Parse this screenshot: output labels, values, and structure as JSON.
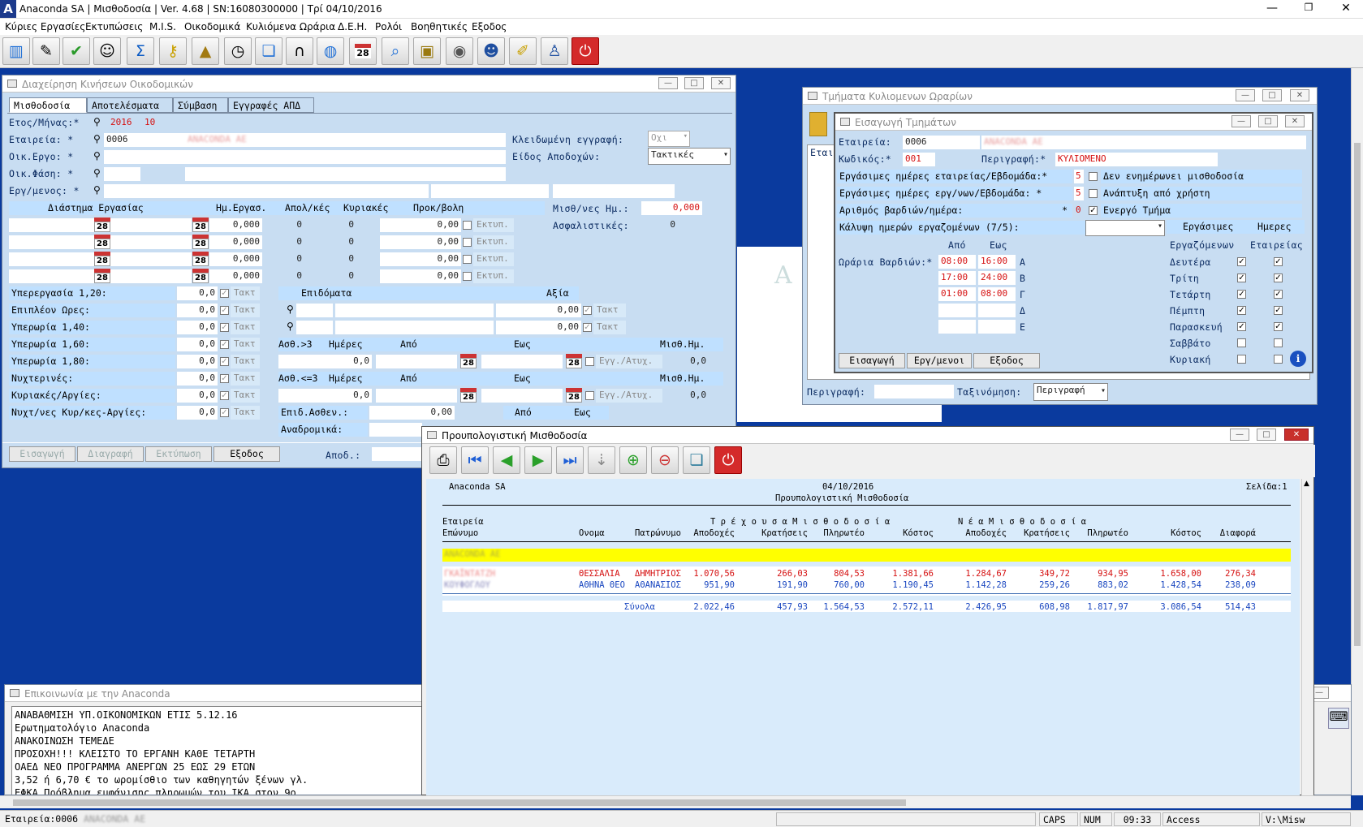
{
  "app": {
    "title": "Anaconda SA | Μισθοδοσία  | Ver. 4.68 | SN:16080300000 | Τρί 04/10/2016"
  },
  "menu": [
    "Κύριες Εργασίες",
    "Εκτυπώσεις",
    "M.I.S.",
    "Οικοδομικά",
    "Κυλιόμενα Ωράρια",
    "Δ.Ε.Η.",
    "Ρολόι",
    "Βοηθητικές",
    "Εξοδος"
  ],
  "toolbar": [
    "building-icon",
    "tools-icon",
    "checklist-icon",
    "users-icon",
    "sigma-icon",
    "key-icon",
    "pyramid-icon",
    "clock-icon",
    "book-icon",
    "headset-icon",
    "globe-icon",
    "calendar-icon",
    "search-screen-icon",
    "lock-icon",
    "database-icon",
    "user-icon",
    "notepad-icon",
    "user-stamp-icon",
    "power-icon"
  ],
  "calendar_day": "28",
  "w1": {
    "title": "Διαχείρηση Κινήσεων Οικοδομικών",
    "tabs": [
      "Μισθοδοσία",
      "Αποτελέσματα",
      "Σύμβαση",
      "Εγγραφές ΑΠΔ"
    ],
    "l_year": "Ετος/Μήνας:*",
    "year": "2016",
    "month": "10",
    "l_company": "Εταιρεία:  *",
    "company_code": "0006",
    "company_name": "ANACONDA AE",
    "l_locked": "Κλειδωμένη εγγραφή:",
    "locked": "Οχι",
    "l_project": "Οικ.Εργο:  *",
    "l_paytype": "Είδος Αποδοχών:",
    "paytype": "Τακτικές",
    "l_phase": "Οικ.Φάση:  *",
    "l_employee": "Εργ/μενος: *",
    "h_period": "Διάστημα Εργασίας",
    "h_days": "Ημ.Εργασ.",
    "h_abs": "Απολ/κές",
    "h_sun": "Κυριακές",
    "h_bonus": "Προκ/βολη",
    "l_wage": "Μισθ/νες Ημ.:",
    "wage": "0,000",
    "l_ins": "Ασφαλιστικές:",
    "ins": "0",
    "days": "0,000",
    "abs": "0",
    "sun": "0",
    "bonus": "0,00",
    "print": "Εκτυπ.",
    "ot_rows": [
      {
        "l": "Υπερεργασία 1,20:"
      },
      {
        "l": "Επιπλέον Ωρες:"
      },
      {
        "l": "Υπερωρία 1,40:"
      },
      {
        "l": "Υπερωρία 1,60:"
      },
      {
        "l": "Υπερωρία 1,80:"
      },
      {
        "l": "Νυχτερινές:"
      },
      {
        "l": "Κυριακές/Αργίες:"
      },
      {
        "l": "Νυχτ/νες Κυρ/κες-Αργίες:"
      }
    ],
    "ot_val": "0,0",
    "tact": "Τακτ",
    "h_benef": "Επιδόματα",
    "h_value": "Αξία",
    "benef_val": "0,00",
    "l_sick3": "Ασθ.>3",
    "l_sick3b": "Ασθ.<=3",
    "h_sdays": "Ημέρες",
    "h_from": "Από",
    "h_to": "Εως",
    "h_sw": "Μισθ.Ημ.",
    "sick_val": "0,0",
    "sick_chk": "Εγγ./Ατυχ.",
    "l_benef2": "Επιδ.Ασθεν.:",
    "benef2": "0,00",
    "l_retro": "Αναδρομικά:",
    "b_insert": "Εισαγωγή",
    "b_delete": "Διαγραφή",
    "b_print": "Εκτύπωση",
    "b_exit": "Εξοδος",
    "l_apod": "Αποδ.:"
  },
  "w2": {
    "title": "Τμήματα Κυλιομενων Ωραρίων",
    "l_company": "Εταιρ",
    "l_desc": "Περιγραφή:",
    "l_sort": "Ταξινόμηση:",
    "sort": "Περιγραφή"
  },
  "w3": {
    "title": "Εισαγωγή Τμημάτων",
    "l_company": "Εταιρεία:",
    "company_code": "0006",
    "company_name": "ANACONDA AE",
    "l_code": "Κωδικός:*",
    "code": "001",
    "l_desc": "Περιγραφή:*",
    "desc": "ΚΥΛΙΟΜΕΝΟ",
    "l_wd_c": "Εργάσιμες ημέρες εταιρείας/Εβδομάδα:*",
    "wd_c": "5",
    "chk1": "Δεν ενημέρωνει μισθοδοσία",
    "l_wd_e": "Εργάσιμες ημέρες εργ/νων/Εβδομάδα:  *",
    "wd_e": "5",
    "chk2": "Ανάπτυξη από χρήστη",
    "l_shifts": "Αριθμός βαρδιών/ημέρα:",
    "shifts": "0",
    "chk3": "Ενεργό Τμήμα",
    "l_cover": "Κάλυψη ημερών εργαζομένων (7/5):",
    "h_from": "Από",
    "h_to": "Εως",
    "l_sched": "Ωράρια Βαρδιών:*",
    "shifts_rows": [
      {
        "f": "08:00",
        "t": "16:00",
        "s": "Α"
      },
      {
        "f": "17:00",
        "t": "24:00",
        "s": "Β"
      },
      {
        "f": "01:00",
        "t": "08:00",
        "s": "Γ"
      },
      {
        "f": "",
        "t": "",
        "s": "Δ"
      },
      {
        "f": "",
        "t": "",
        "s": "Ε"
      }
    ],
    "h_wd": "Εργάσιμες",
    "h_days": "Ημερες",
    "h_emp": "Εργαζόμενων",
    "h_comp": "Εταιρείας",
    "days": [
      {
        "n": "Δευτέρα",
        "e": true,
        "c": true
      },
      {
        "n": "Τρίτη",
        "e": true,
        "c": true
      },
      {
        "n": "Τετάρτη",
        "e": true,
        "c": true
      },
      {
        "n": "Πέμπτη",
        "e": true,
        "c": true
      },
      {
        "n": "Παρασκευή",
        "e": true,
        "c": true
      },
      {
        "n": "Σαββάτο",
        "e": false,
        "c": false
      },
      {
        "n": "Κυριακή",
        "e": false,
        "c": false
      }
    ],
    "b_insert": "Εισαγωγή",
    "b_emp": "Εργ/μενοι",
    "b_exit": "Εξοδος"
  },
  "w4": {
    "title": "Προυπολογιστική Μισθοδοσία",
    "company": "Anaconda SA",
    "date": "04/10/2016",
    "page": "Σελίδα:1",
    "report": "Προυπολογιστική Μισθοδοσία",
    "g_cur": "Τ ρ έ χ ο υ σ α   Μ ι σ θ ο δ ο σ ί α",
    "g_new": "Ν έ α   Μ ι σ θ ο δ ο σ ί α",
    "h_company": "Εταιρεία",
    "h_surname": "Επώνυμο",
    "h_name": "Ονομα",
    "h_father": "Πατρώνυμο",
    "h_cols": [
      "Αποδοχές",
      "Κρατήσεις",
      "Πληρωτέο",
      "Κόστος",
      "Αποδοχές",
      "Κρατήσεις",
      "Πληρωτέο",
      "Κόστος",
      "Διαφορά"
    ],
    "group": "ANACONDA AE",
    "rows": [
      {
        "s": "ΓΚΑΪΝΤΑΤΖΗ",
        "n": "ΘΕΣΣΑΛΙΑ",
        "f": "ΔΗΜΗΤΡΙΟΣ",
        "v": [
          "1.070,56",
          "266,03",
          "804,53",
          "1.381,66",
          "1.284,67",
          "349,72",
          "934,95",
          "1.658,00",
          "276,34"
        ]
      },
      {
        "s": "ΚΟΥΦΟΓΛΟΥ",
        "n": "ΑΘΗΝΑ ΘΕΟ",
        "f": "ΑΘΑΝΑΣΙΟΣ",
        "v": [
          "951,90",
          "191,90",
          "760,00",
          "1.190,45",
          "1.142,28",
          "259,26",
          "883,02",
          "1.428,54",
          "238,09"
        ]
      }
    ],
    "totals_label": "Σύνολα",
    "totals": [
      "2.022,46",
      "457,93",
      "1.564,53",
      "2.572,11",
      "2.426,95",
      "608,98",
      "1.817,97",
      "3.086,54",
      "514,43"
    ]
  },
  "w5": {
    "title": "Επικοινωνία με την Anaconda",
    "lines": [
      "ΑΝΑΒΑΘΜΙΣΗ ΥΠ.ΟΙΚΟΝΟΜΙΚΩΝ ΕΤΙΣ 5.12.16",
      "Ερωτηματολόγιο Anaconda",
      "ΑΝΑΚΟΙΝΩΣΗ ΤΕΜΕΔΕ",
      "ΠΡΟΣΟΧΗ!!! ΚΛΕΙΣΤΟ ΤΟ ΕΡΓΑΝΗ ΚΑΘΕ ΤΕΤΑΡΤΗ",
      "ΟΑΕΔ ΝΕΟ ΠΡΟΓΡΑΜΜΑ ΑΝΕΡΓΩΝ 25 ΕΩΣ 29 ΕΤΩΝ",
      "3,52 ή 6,70 € το ωρομίσθιο των καθηγητών ξένων γλ.",
      "ΕΦΚΑ Πρόβλημα εμφάνισης πληρωμών του ΙΚΑ στον 9ο"
    ]
  },
  "status": {
    "company": "Εταιρεία:0006",
    "company_name": "ANACONDA AE",
    "caps": "CAPS",
    "num": "NUM",
    "time": "09:33",
    "app": "Access",
    "path": "V:\\Misw"
  }
}
